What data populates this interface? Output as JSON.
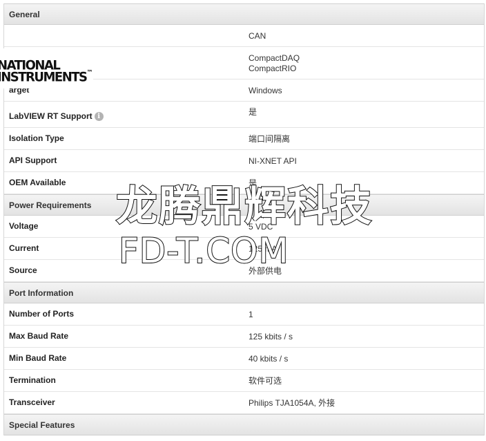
{
  "sections": [
    {
      "title": "General",
      "rows": [
        {
          "label": "",
          "value": "CAN"
        },
        {
          "label": "",
          "value": "CompactDAQ\nCompactRIO"
        },
        {
          "label": "arget",
          "value": "Windows"
        },
        {
          "label": "LabVIEW RT Support",
          "value": "是",
          "info": true
        },
        {
          "label": "Isolation Type",
          "value": "端口间隔离"
        },
        {
          "label": "API Support",
          "value": "NI-XNET API"
        },
        {
          "label": "OEM Available",
          "value": "是"
        }
      ]
    },
    {
      "title": "Power Requirements",
      "rows": [
        {
          "label": "Voltage",
          "value": "5 VDC"
        },
        {
          "label": "Current",
          "value": "125 mA"
        },
        {
          "label": "Source",
          "value": "外部供电"
        }
      ]
    },
    {
      "title": "Port Information",
      "rows": [
        {
          "label": "Number of Ports",
          "value": "1"
        },
        {
          "label": "Max Baud Rate",
          "value": "125 kbits / s"
        },
        {
          "label": "Min Baud Rate",
          "value": "40 kbits / s"
        },
        {
          "label": "Termination",
          "value": "软件可选"
        },
        {
          "label": "Transceiver",
          "value": "Philips TJA1054A, 外接"
        }
      ]
    },
    {
      "title": "Special Features",
      "rows": []
    }
  ],
  "logo": {
    "line1": "NATIONAL",
    "line2": "INSTRUMENTS",
    "mark": "™"
  },
  "watermark": {
    "chinese": "龙腾鼎辉科技",
    "url": "FD-T.COM"
  },
  "info_icon_glyph": "i"
}
